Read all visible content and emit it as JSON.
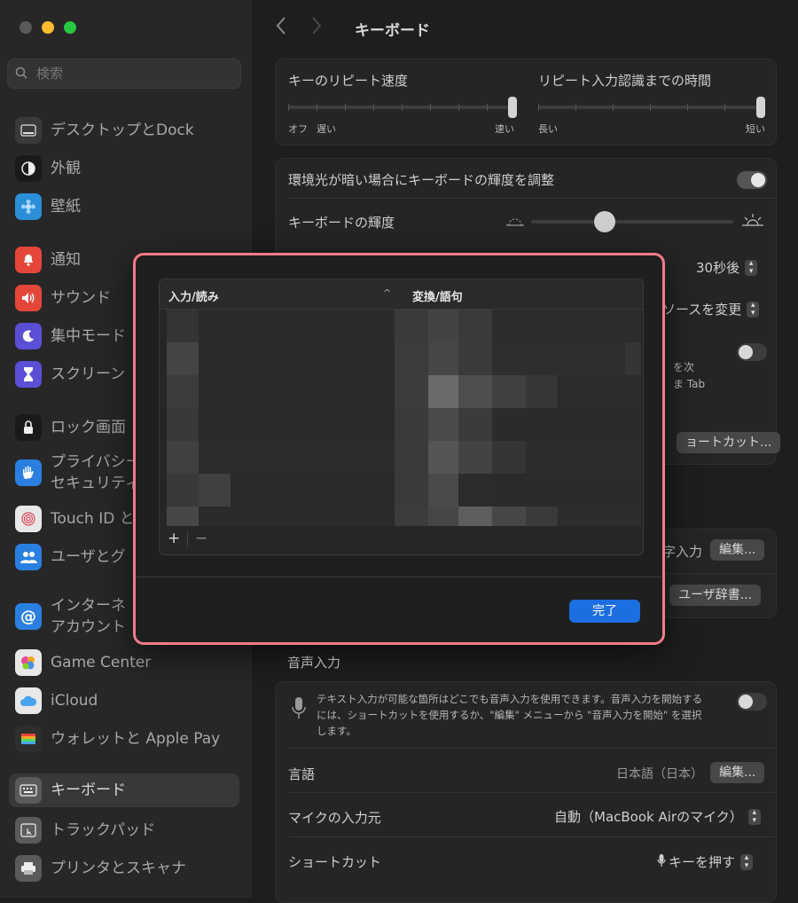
{
  "sidebar": {
    "search_placeholder": "検索",
    "items": [
      {
        "label": "デスクトップとDock",
        "icon": "dock-icon",
        "color": "#3a3a3a"
      },
      {
        "label": "外観",
        "icon": "appearance-icon",
        "color": "#1a1a1a"
      },
      {
        "label": "壁紙",
        "icon": "wallpaper-icon",
        "color": "#2a8fd6"
      },
      {
        "label": "通知",
        "icon": "bell-icon",
        "color": "#e5463a"
      },
      {
        "label": "サウンド",
        "icon": "speaker-icon",
        "color": "#e5463a"
      },
      {
        "label": "集中モード",
        "icon": "moon-icon",
        "color": "#5b4fd6"
      },
      {
        "label": "スクリーン",
        "icon": "hourglass-icon",
        "color": "#5b4fd6"
      },
      {
        "label": "ロック画面",
        "icon": "lock-icon",
        "color": "#1a1a1a"
      },
      {
        "label": "プライバシー",
        "label2": "セキュリティ",
        "icon": "hand-icon",
        "color": "#2a7fe0"
      },
      {
        "label": "Touch ID と",
        "icon": "fingerprint-icon",
        "color": "#e8e8e8"
      },
      {
        "label": "ユーザとグ",
        "icon": "users-icon",
        "color": "#2a7fe0"
      },
      {
        "label": "インターネ",
        "label2": "アカウント",
        "icon": "at-icon",
        "color": "#2a7fe0"
      },
      {
        "label": "Game Center",
        "icon": "game-center-icon",
        "color": "#e8e8e8"
      },
      {
        "label": "iCloud",
        "icon": "cloud-icon",
        "color": "#4aa3f0"
      },
      {
        "label": "ウォレットと Apple Pay",
        "icon": "wallet-icon",
        "color": "#2e2e2e"
      },
      {
        "label": "キーボード",
        "icon": "keyboard-icon",
        "color": "#5a5a5a"
      },
      {
        "label": "トラックパッド",
        "icon": "trackpad-icon",
        "color": "#5a5a5a"
      },
      {
        "label": "プリンタとスキャナ",
        "icon": "printer-icon",
        "color": "#5a5a5a"
      }
    ]
  },
  "main": {
    "title": "キーボード",
    "repeat": {
      "speed_label": "キーのリピート速度",
      "delay_label": "リピート入力認識までの時間",
      "off": "オフ",
      "slow": "遅い",
      "fast": "速い",
      "long": "長い",
      "short": "短い"
    },
    "brightness": {
      "adjust_label": "環境光が暗い場合にキーボードの輝度を調整",
      "level_label": "キーボードの輝度",
      "level": 0.35
    },
    "timeout_value": "30秒後",
    "input_source_value": "ソースを変更",
    "tab_text1": "を次",
    "tab_text2": "ま Tab",
    "shortcut_btn": "ョートカット...",
    "text_input_label": "字入力",
    "edit_btn": "編集...",
    "user_dict_btn": "ユーザ辞書...",
    "voice": {
      "section": "音声入力",
      "description": "テキスト入力が可能な箇所はどこでも音声入力を使用できます。音声入力を開始するには、ショートカットを使用するか、\"編集\" メニューから \"音声入力を開始\" を選択します。",
      "language_label": "言語",
      "language_value": "日本語（日本）",
      "language_btn": "編集...",
      "mic_label": "マイクの入力元",
      "mic_value": "自動（MacBook Airのマイク）",
      "shortcut_label": "ショートカット",
      "shortcut_value": "キーを押す"
    }
  },
  "modal": {
    "col_input": "入力/読み",
    "col_convert": "変換/語句",
    "sort_glyph": "^",
    "add": "+",
    "remove": "−",
    "done": "完了"
  }
}
